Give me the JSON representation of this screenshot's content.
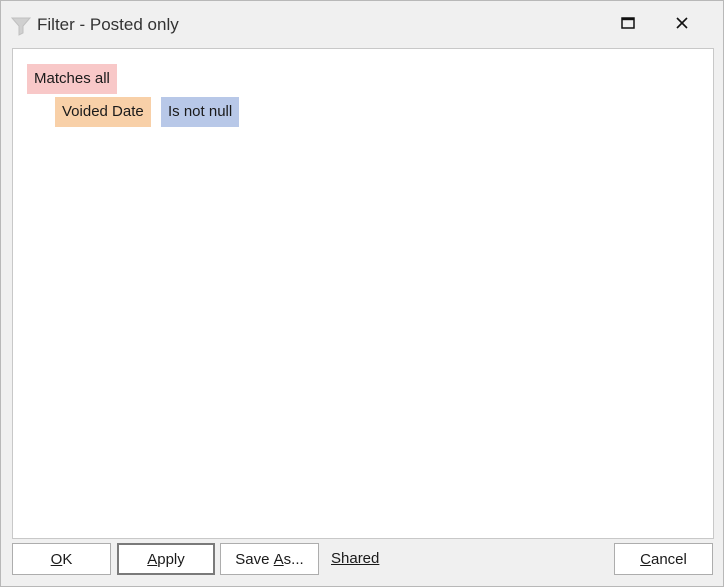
{
  "window": {
    "title": "Filter - Posted only"
  },
  "filter": {
    "group_label": "Matches all",
    "condition": {
      "field": "Voided Date",
      "operator": "Is not null"
    }
  },
  "buttons": {
    "ok": {
      "mnemonic": "O",
      "rest": "K"
    },
    "apply": {
      "mnemonic": "A",
      "rest": "pply"
    },
    "save_as": {
      "before": "Save ",
      "mnemonic": "A",
      "rest": "s..."
    },
    "shared": "Shared",
    "cancel": {
      "mnemonic": "C",
      "rest": "ancel"
    }
  },
  "colors": {
    "group_tag": "#f8c8c8",
    "field_tag": "#f8d0a8",
    "operator_tag": "#b8c8e8"
  },
  "icons": {
    "title": "funnel-icon",
    "maximize": "maximize-icon",
    "close": "close-icon"
  }
}
